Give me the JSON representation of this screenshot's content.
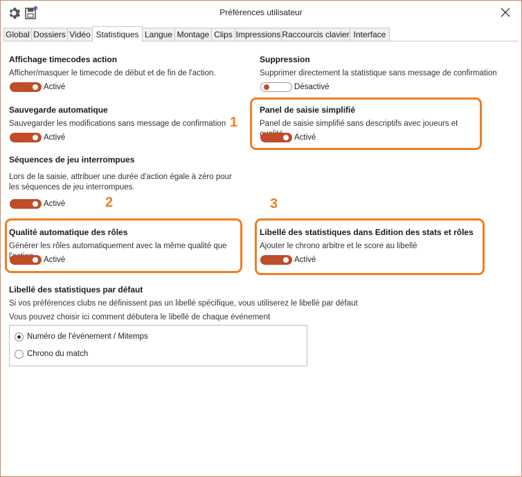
{
  "window": {
    "title": "Préférences utilisateur"
  },
  "tabs": [
    {
      "label": "Global"
    },
    {
      "label": "Dossiers"
    },
    {
      "label": "Vidéo"
    },
    {
      "label": "Statistiques"
    },
    {
      "label": "Langue"
    },
    {
      "label": "Montage"
    },
    {
      "label": "Clips"
    },
    {
      "label": "Impressions"
    },
    {
      "label": "Raccourcis clavier"
    },
    {
      "label": "Interface"
    }
  ],
  "active_tab": "Statistiques",
  "settings": {
    "affichage": {
      "title": "Affichage timecodes action",
      "desc": "Afficher/masquer le timecode de début et de fin de l'action.",
      "state": "Activé",
      "on": true
    },
    "suppression": {
      "title": "Suppression",
      "desc": "Supprimer directement la statistique sans message de confirmation",
      "state": "Désactivé",
      "on": false
    },
    "sauvegarde": {
      "title": "Sauvegarde automatique",
      "desc": "Sauvegarder les modifications sans message de confirmation",
      "state": "Activé",
      "on": true
    },
    "panel": {
      "title": "Panel de saisie simplifié",
      "desc": "Panel de saisie simplifié sans descriptifs avec joueurs et qualité",
      "state": "Activé",
      "on": true
    },
    "sequences": {
      "title": "Séquences de jeu interrompues",
      "desc_line1": "Lors de la saisie, attribuer une durée d'action égale à zéro pour",
      "desc_line2": "les séquences de jeu interrompues.",
      "state": "Activé",
      "on": true
    },
    "qualite": {
      "title": "Qualité automatique des rôles",
      "desc": "Générer les rôles automatiquement avec la même qualité que l'action",
      "state": "Activé",
      "on": true
    },
    "libelle_edition": {
      "title": "Libellé des statistiques dans Edition des stats et rôles",
      "desc": "Ajouter le chrono arbitre et le score au libellé",
      "state": "Activé",
      "on": true
    },
    "libelle_defaut": {
      "title": "Libellé des statistiques par défaut",
      "desc1": "Si vos préférences clubs ne définissent pas un libellé spécifique, vous utiliserez le libellé par défaut",
      "desc2": "Vous pouvez choisir ici comment débutera le libellé de chaque événement",
      "options": [
        {
          "label": "Numéro de l'événement / Mitemps",
          "checked": true
        },
        {
          "label": "Chrono du match",
          "checked": false
        }
      ]
    }
  },
  "callouts": [
    "1",
    "2",
    "3"
  ],
  "colors": {
    "toggle_on": "#c04c2a",
    "highlight": "#f07d1f"
  }
}
